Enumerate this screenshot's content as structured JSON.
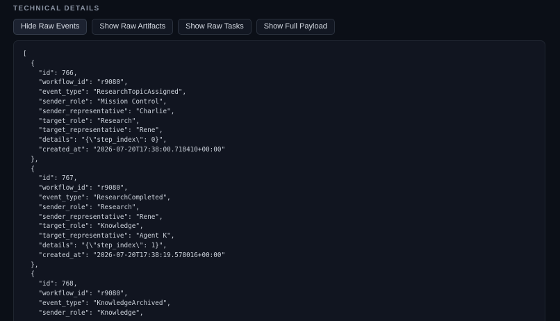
{
  "section": {
    "title": "TECHNICAL DETAILS"
  },
  "toolbar": {
    "buttons": [
      {
        "label": "Hide Raw Events",
        "active": true
      },
      {
        "label": "Show Raw Artifacts",
        "active": false
      },
      {
        "label": "Show Raw Tasks",
        "active": false
      },
      {
        "label": "Show Full Payload",
        "active": false
      }
    ]
  },
  "raw_events": {
    "lines": [
      "[",
      "  {",
      "    \"id\": 766,",
      "    \"workflow_id\": \"r9080\",",
      "    \"event_type\": \"ResearchTopicAssigned\",",
      "    \"sender_role\": \"Mission Control\",",
      "    \"sender_representative\": \"Charlie\",",
      "    \"target_role\": \"Research\",",
      "    \"target_representative\": \"Rene\",",
      "    \"details\": \"{\\\"step_index\\\": 0}\",",
      "    \"created_at\": \"2026-07-20T17:38:00.718410+00:00\"",
      "  },",
      "  {",
      "    \"id\": 767,",
      "    \"workflow_id\": \"r9080\",",
      "    \"event_type\": \"ResearchCompleted\",",
      "    \"sender_role\": \"Research\",",
      "    \"sender_representative\": \"Rene\",",
      "    \"target_role\": \"Knowledge\",",
      "    \"target_representative\": \"Agent K\",",
      "    \"details\": \"{\\\"step_index\\\": 1}\",",
      "    \"created_at\": \"2026-07-20T17:38:19.578016+00:00\"",
      "  },",
      "  {",
      "    \"id\": 768,",
      "    \"workflow_id\": \"r9080\",",
      "    \"event_type\": \"KnowledgeArchived\",",
      "    \"sender_role\": \"Knowledge\","
    ]
  }
}
